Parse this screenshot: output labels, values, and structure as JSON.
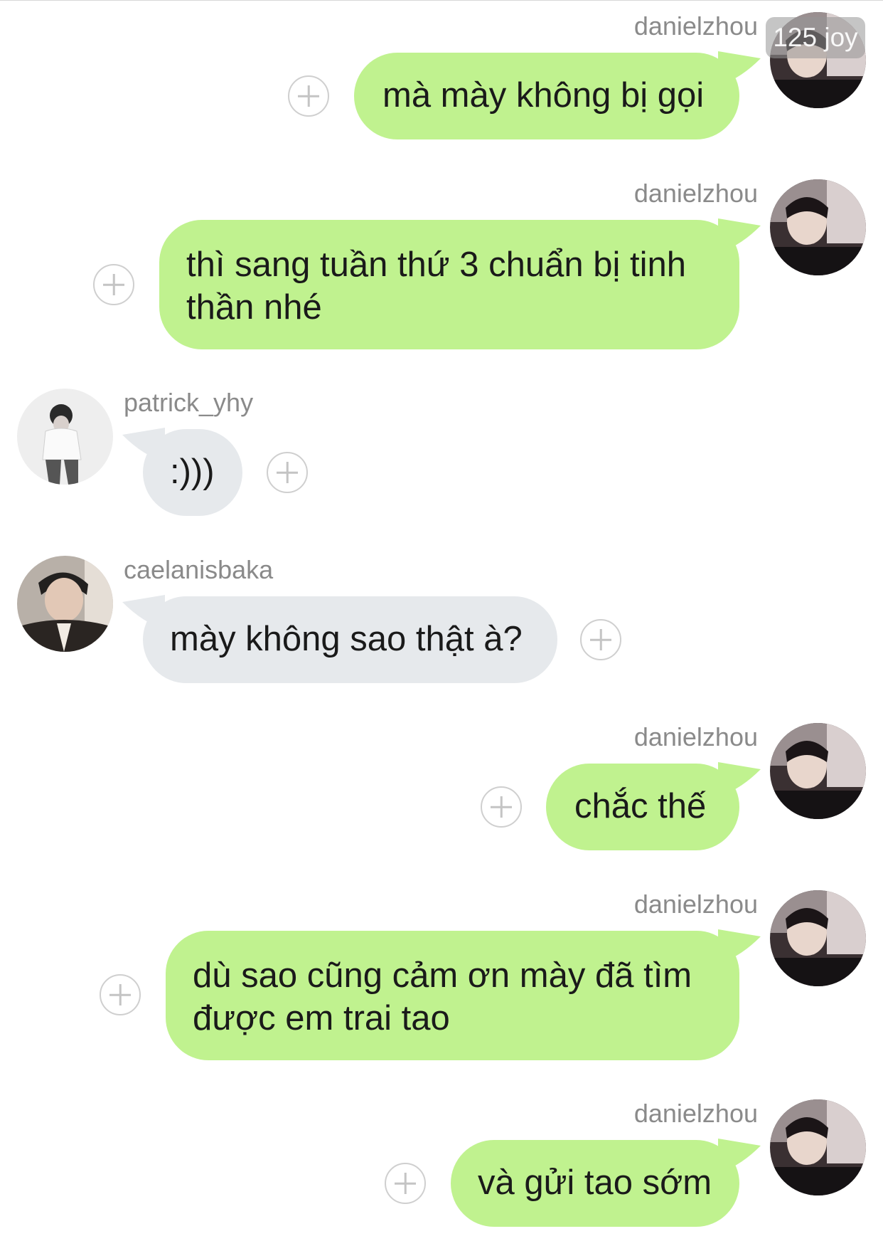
{
  "watermark": "125 joy",
  "messages": [
    {
      "user": "danielzhou",
      "text": "mà mày không bị gọi",
      "side": "sent"
    },
    {
      "user": "danielzhou",
      "text_lines": [
        "thì sang tuần thứ 3 chuẩn bị tinh",
        "thần nhé"
      ],
      "side": "sent"
    },
    {
      "user": "patrick_yhy",
      "text": ":)))",
      "side": "received"
    },
    {
      "user": "caelanisbaka",
      "text": "mày không sao thật à?",
      "side": "received"
    },
    {
      "user": "danielzhou",
      "text": "chắc thế",
      "side": "sent"
    },
    {
      "user": "danielzhou",
      "text_lines": [
        "dù sao cũng cảm ơn mày đã tìm",
        "được em trai tao"
      ],
      "side": "sent"
    },
    {
      "user": "danielzhou",
      "text": "và gửi tao sớm",
      "side": "sent"
    }
  ],
  "colors": {
    "sent_bubble": "#c0f28f",
    "received_bubble": "#e6e9ec",
    "username": "#8a8a8a",
    "add_icon": "#cfcfcf"
  },
  "icons": {
    "add": "plus-circle-icon"
  }
}
